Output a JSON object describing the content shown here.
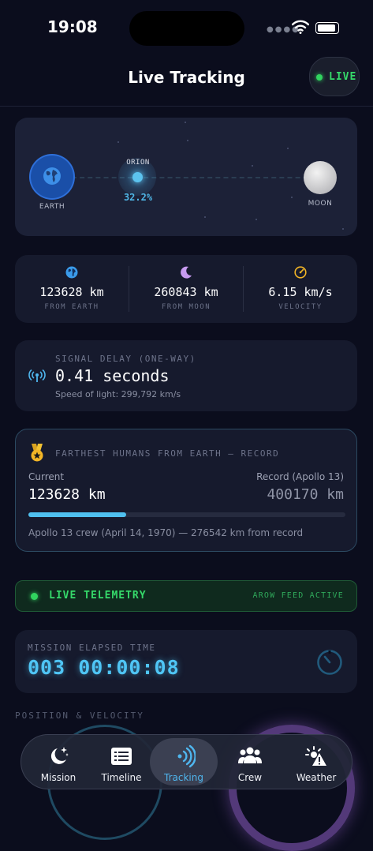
{
  "status": {
    "time": "19:08"
  },
  "header": {
    "title": "Live Tracking",
    "live_label": "LIVE"
  },
  "orbit": {
    "earth_label": "EARTH",
    "craft_label": "ORION",
    "progress_text": "32.2%",
    "progress_fraction": 0.322,
    "moon_label": "MOON"
  },
  "stats": [
    {
      "icon": "globe-icon",
      "value": "123628 km",
      "label": "FROM EARTH"
    },
    {
      "icon": "moon-icon",
      "value": "260843 km",
      "label": "FROM MOON"
    },
    {
      "icon": "speedometer-icon",
      "value": "6.15 km/s",
      "label": "VELOCITY"
    }
  ],
  "signal": {
    "title": "SIGNAL DELAY (ONE-WAY)",
    "value": "0.41 seconds",
    "subtitle": "Speed of light: 299,792 km/s"
  },
  "record": {
    "title": "FARTHEST HUMANS FROM EARTH — RECORD",
    "current_label": "Current",
    "current_value": "123628 km",
    "record_label": "Record (Apollo 13)",
    "record_value": "400170 km",
    "progress_fraction": 0.309,
    "note": "Apollo 13 crew (April 14, 1970) — 276542 km from record"
  },
  "telemetry": {
    "title": "LIVE TELEMETRY",
    "status": "AROW FEED ACTIVE"
  },
  "met": {
    "title": "MISSION ELAPSED TIME",
    "value": "003 00:00:08"
  },
  "section_title": "POSITION & VELOCITY",
  "tabs": [
    {
      "label": "Mission",
      "icon": "moon-stars-icon"
    },
    {
      "label": "Timeline",
      "icon": "list-icon"
    },
    {
      "label": "Tracking",
      "icon": "antenna-icon",
      "active": true
    },
    {
      "label": "Crew",
      "icon": "people-icon"
    },
    {
      "label": "Weather",
      "icon": "weather-alert-icon"
    }
  ],
  "colors": {
    "accent": "#4fb6ee",
    "live_green": "#35d96a",
    "background": "#0b0d1d",
    "card": "#161a2d"
  }
}
